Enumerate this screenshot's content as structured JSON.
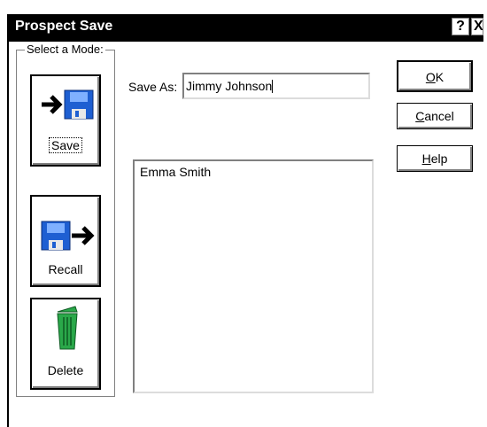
{
  "window": {
    "title": "Prospect Save",
    "help_glyph": "?",
    "close_glyph": "X"
  },
  "mode_group": {
    "label": "Select a Mode:",
    "buttons": [
      {
        "label": "Save",
        "icon": "arrow-to-disk-icon"
      },
      {
        "label": "Recall",
        "icon": "disk-to-arrow-icon"
      },
      {
        "label": "Delete",
        "icon": "trash-can-icon"
      }
    ]
  },
  "save_as": {
    "label": "Save As:",
    "value": "Jimmy Johnson"
  },
  "list": {
    "items": [
      "Emma Smith"
    ]
  },
  "commands": {
    "ok": {
      "first": "O",
      "rest": "K"
    },
    "cancel": {
      "first": "C",
      "rest": "ancel"
    },
    "help": {
      "first": "H",
      "rest": "elp"
    }
  },
  "colors": {
    "titlebar": "#000000",
    "disk_blue": "#1e5fd2",
    "trash_green": "#2aa84a"
  }
}
